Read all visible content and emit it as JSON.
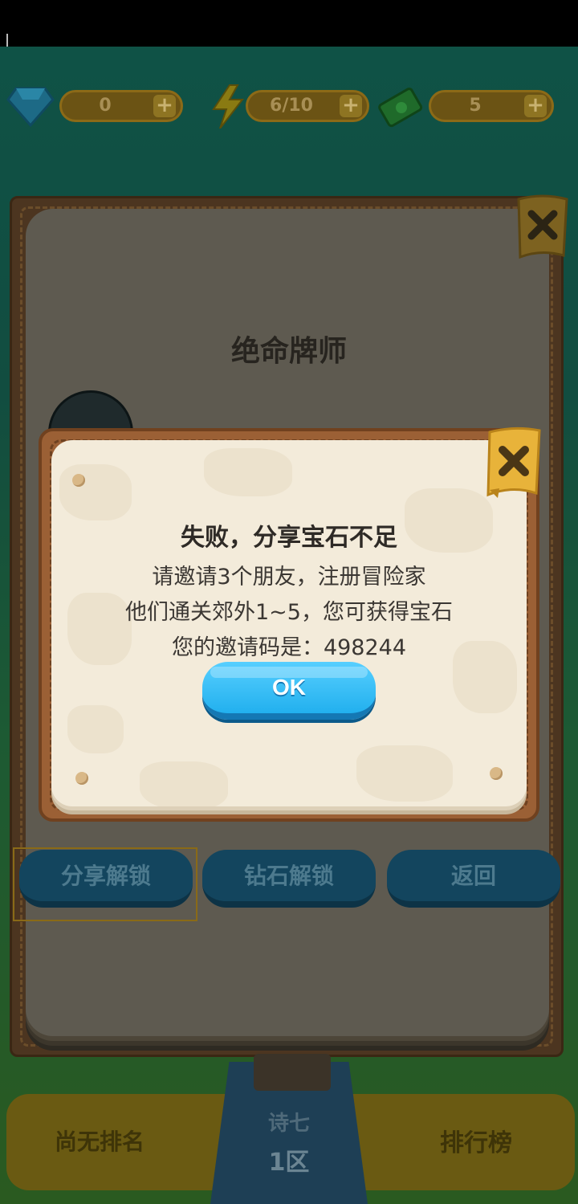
{
  "resources": {
    "gems": "0",
    "energy": "6/10",
    "cash": "5",
    "plus": "+"
  },
  "outer_panel": {
    "title": "绝命牌师"
  },
  "dialog": {
    "title": "失败，分享宝石不足",
    "lines": [
      "请邀请3个朋友，注册冒险家",
      "他们通关郊外1~5，您可获得宝石",
      "您的邀请码是：498244"
    ],
    "ok_label": "OK"
  },
  "actions": {
    "share_unlock": "分享解锁",
    "diamond_unlock": "钻石解锁",
    "back": "返回"
  },
  "bottom": {
    "rank": "尚无排名",
    "server_name": "诗七",
    "server_zone": "1区",
    "leaderboard": "排行榜"
  },
  "colors": {
    "accent_blue": "#22b0ee",
    "close_gold": "#e8b33a",
    "panel_cream": "#f3ebda",
    "panel_wood": "#9b6035"
  }
}
